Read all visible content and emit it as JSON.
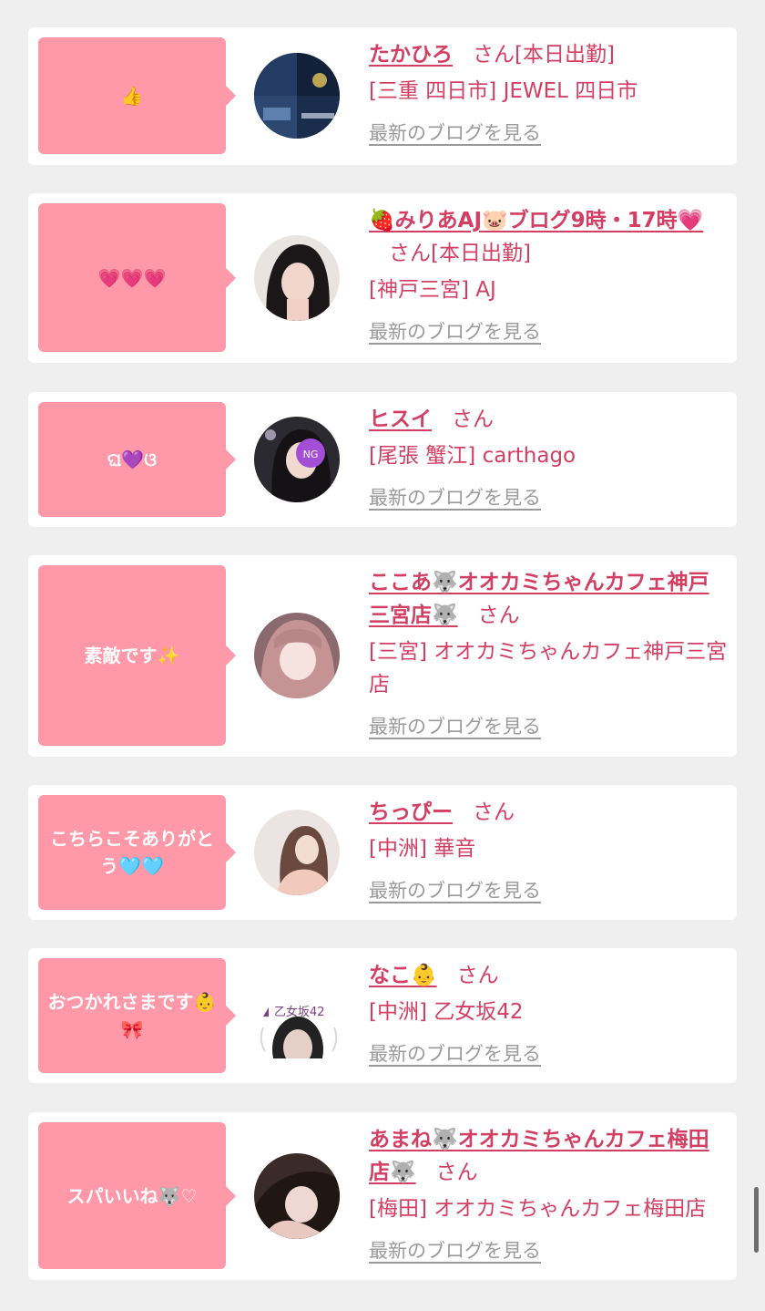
{
  "colors": {
    "background": "#efefef",
    "card": "#ffffff",
    "bubble": "#ff98a8",
    "accent": "#d23f63",
    "link_gray": "#9a9a9a"
  },
  "entries": [
    {
      "reaction": "👍",
      "name": "たかひろ",
      "san": "さん",
      "status": "[本日出勤]",
      "location": "[三重 四日市] JEWEL 四日市",
      "blog_link": "最新のブログを見る",
      "avatar_icon": "night-city-photo-avatar"
    },
    {
      "reaction": "💗💗💗",
      "name": "🍓みりあAJ🐷ブログ9時・17時💗",
      "san": "さん",
      "status": "[本日出勤]",
      "location": "[神戸三宮] AJ",
      "blog_link": "最新のブログを見る",
      "avatar_icon": "woman-photo-avatar"
    },
    {
      "reaction": "ଘ💜ଓ",
      "name": "ヒスイ",
      "san": "さん",
      "status": "",
      "location": "[尾張 蟹江] carthago",
      "blog_link": "最新のブログを見る",
      "avatar_icon": "woman-photo-avatar"
    },
    {
      "reaction": "素敵です✨",
      "name": "ここあ🐺オオカミちゃんカフェ神戸三宮店🐺",
      "san": "さん",
      "status": "",
      "location": "[三宮] オオカミちゃんカフェ神戸三宮店",
      "blog_link": "最新のブログを見る",
      "avatar_icon": "woman-photo-avatar"
    },
    {
      "reaction": "こちらこそありがとう🩵🩵",
      "name": "ちっぴー",
      "san": "さん",
      "status": "",
      "location": "[中洲] 華音",
      "blog_link": "最新のブログを見る",
      "avatar_icon": "woman-photo-avatar"
    },
    {
      "reaction": "おつかれさまです👶🎀",
      "name": "なこ👶",
      "san": "さん",
      "status": "",
      "location": "[中洲] 乙女坂42",
      "blog_link": "最新のブログを見る",
      "avatar_icon": "shop-logo-avatar",
      "avatar_logo_text": "乙女坂42"
    },
    {
      "reaction": "スパいいね🐺♡",
      "name": "あまね🐺オオカミちゃんカフェ梅田店🐺",
      "san": "さん",
      "status": "",
      "location": "[梅田] オオカミちゃんカフェ梅田店",
      "blog_link": "最新のブログを見る",
      "avatar_icon": "woman-photo-avatar"
    }
  ]
}
